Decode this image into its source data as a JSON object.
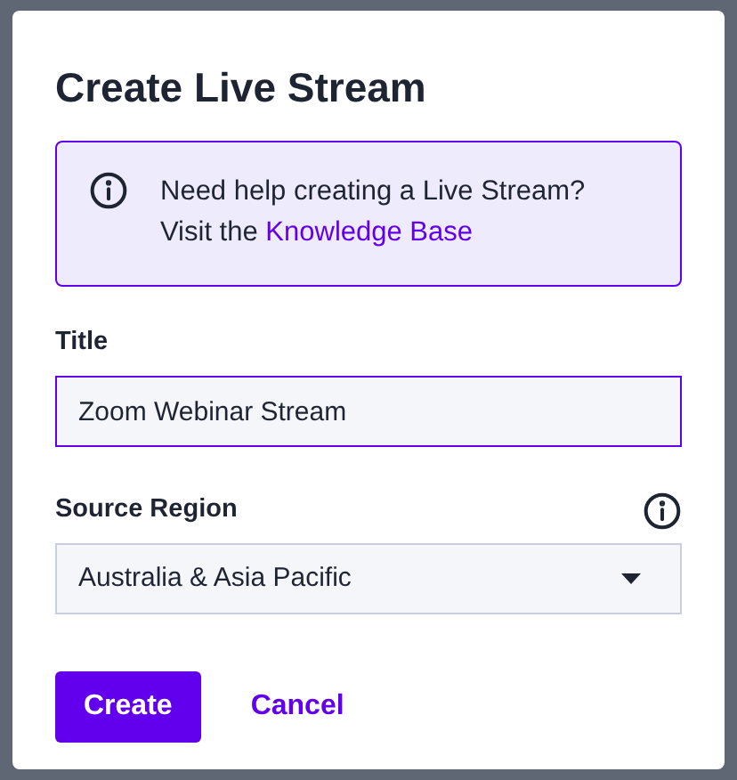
{
  "dialog": {
    "title": "Create Live Stream",
    "notice": {
      "text": "Need help creating a Live Stream?",
      "prefix": "Visit the",
      "link": "Knowledge Base"
    },
    "fields": [
      {
        "kind": "text",
        "label": "Title",
        "value": "Zoom Webinar Stream",
        "focused": true,
        "info": false
      },
      {
        "kind": "select",
        "label": "Source Region",
        "value": "Australia & Asia Pacific",
        "focused": false,
        "info": true
      }
    ],
    "buttons": [
      {
        "kind": "primary",
        "label": "Create"
      },
      {
        "kind": "link",
        "label": "Cancel"
      }
    ]
  }
}
